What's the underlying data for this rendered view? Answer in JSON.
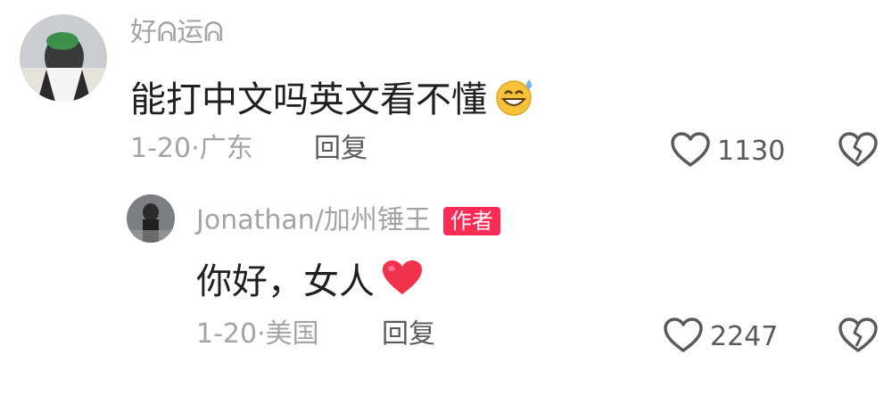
{
  "comments": [
    {
      "username": "好ᕱ运ᕱ",
      "text": "能打中文吗英文看不懂",
      "emoji": "grinning-sweat-emoji",
      "date": "1-20",
      "location": "广东",
      "reply_label": "回复",
      "likes": "1130"
    },
    {
      "username": "Jonathan/加州锤王",
      "badge": "作者",
      "text": "你好，女人",
      "emoji": "red-heart-emoji",
      "date": "1-20",
      "location": "美国",
      "reply_label": "回复",
      "likes": "2247"
    }
  ],
  "separator": "·",
  "colors": {
    "badge": "#fe2c55",
    "muted_text": "#a3a3a8",
    "heart": "#f0324b"
  }
}
